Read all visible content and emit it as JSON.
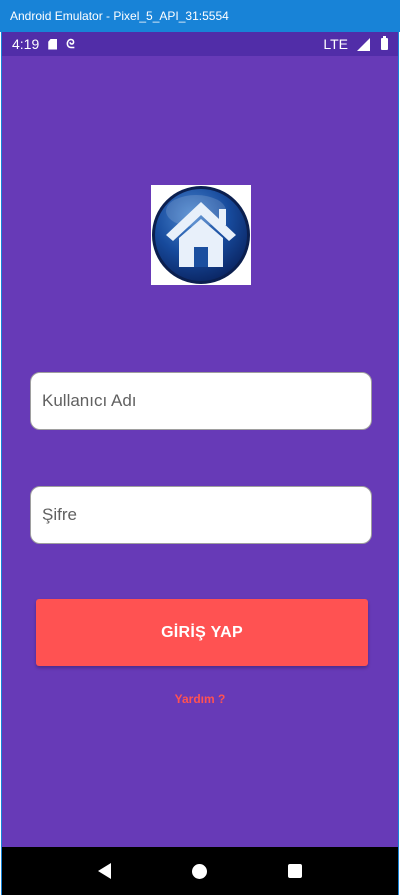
{
  "window": {
    "title": "Android Emulator - Pixel_5_API_31:5554"
  },
  "status_bar": {
    "time": "4:19",
    "network": "LTE",
    "icons": [
      "sd-card-icon",
      "debug-icon",
      "signal-icon",
      "battery-icon"
    ]
  },
  "logo": {
    "icon": "home-icon"
  },
  "form": {
    "username_placeholder": "Kullanıcı Adı",
    "password_placeholder": "Şifre",
    "login_label": "GİRİŞ YAP",
    "help_label": "Yardım ?"
  },
  "nav": {
    "icons": [
      "back-icon",
      "home-icon",
      "recents-icon"
    ]
  },
  "colors": {
    "background": "#673ab7",
    "status_bar": "#512da8",
    "accent": "#ff5252",
    "title_bar": "#1883d7"
  }
}
